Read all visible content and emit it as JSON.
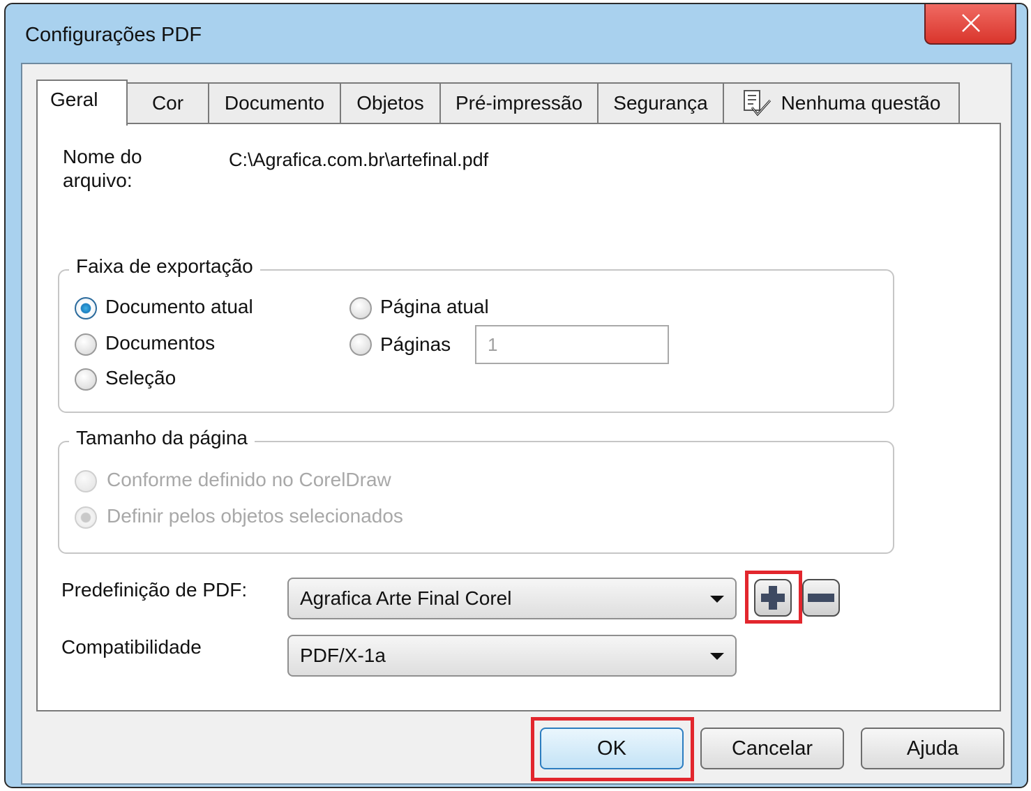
{
  "window": {
    "title": "Configurações PDF"
  },
  "tabs": [
    {
      "label": "Geral",
      "active": true
    },
    {
      "label": "Cor"
    },
    {
      "label": "Documento"
    },
    {
      "label": "Objetos"
    },
    {
      "label": "Pré-impressão"
    },
    {
      "label": "Segurança"
    },
    {
      "label": "Nenhuma questão",
      "icon": "checklist-icon"
    }
  ],
  "general": {
    "filename_label": "Nome do arquivo:",
    "filename_value": "C:\\Agrafica.com.br\\artefinal.pdf",
    "export_range": {
      "legend": "Faixa de exportação",
      "options": {
        "current_document": "Documento atual",
        "documents": "Documentos",
        "selection": "Seleção",
        "current_page": "Página atual",
        "pages": "Páginas"
      },
      "selected": "current_document",
      "pages_value": "1"
    },
    "page_size": {
      "legend": "Tamanho da página",
      "options": {
        "as_defined": "Conforme definido no CorelDraw",
        "by_selected": "Definir pelos objetos selecionados"
      },
      "selected": "by_selected",
      "enabled": false
    },
    "preset": {
      "label": "Predefinição de PDF:",
      "value": "Agrafica Arte Final Corel"
    },
    "compatibility": {
      "label": "Compatibilidade",
      "value": "PDF/X-1a"
    }
  },
  "buttons": {
    "ok": "OK",
    "cancel": "Cancelar",
    "help": "Ajuda"
  },
  "colors": {
    "title_bar": "#a9d1ee",
    "close": "#e0443a",
    "highlight": "#e2262d",
    "accent": "#2c7dc0"
  }
}
